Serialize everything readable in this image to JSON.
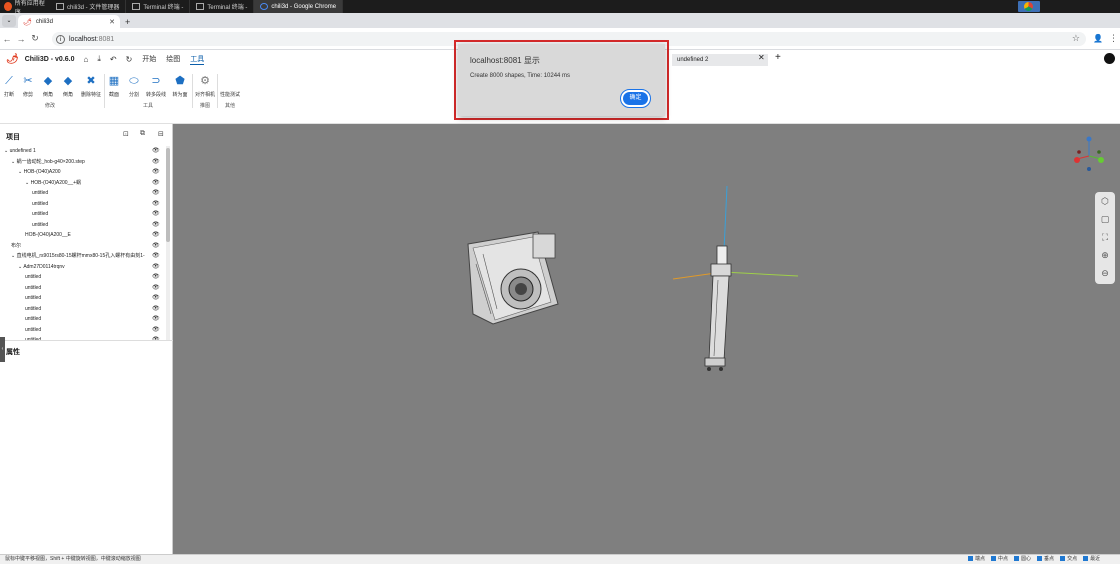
{
  "taskbar": {
    "start_label": "所有应用程序",
    "items": [
      {
        "label": "chili3d - 文件管理器",
        "active": false
      },
      {
        "label": "Terminal 终端 -",
        "active": false
      },
      {
        "label": "Terminal 终端 -",
        "active": false
      },
      {
        "label": "chili3d - Google Chrome",
        "active": true
      }
    ]
  },
  "browser": {
    "tab_title": "chili3d",
    "url_host": "localhost",
    "url_port": ":8081"
  },
  "app": {
    "title": "Chili3D - v0.6.0",
    "menus": [
      {
        "label": "开始",
        "active": false
      },
      {
        "label": "绘图",
        "active": false
      },
      {
        "label": "工具",
        "active": true
      }
    ],
    "doc_tab": "undefined 2"
  },
  "ribbon": {
    "tools": [
      {
        "label": "打断",
        "icon": "break-icon",
        "glyph": "⟋"
      },
      {
        "label": "修剪",
        "icon": "trim-icon",
        "glyph": "✂"
      },
      {
        "label": "倒角",
        "icon": "chamfer-icon",
        "glyph": "◆"
      },
      {
        "label": "倒角",
        "icon": "fillet-icon",
        "glyph": "◆"
      },
      {
        "label": "删除特征",
        "icon": "remove-feature-icon",
        "glyph": "✖"
      },
      {
        "label": "截面",
        "icon": "section-icon",
        "glyph": "▦"
      },
      {
        "label": "分割",
        "icon": "split-icon",
        "glyph": "⬭"
      },
      {
        "label": "转多段线",
        "icon": "polyline-icon",
        "glyph": "⊃"
      },
      {
        "label": "转为面",
        "icon": "to-face-icon",
        "glyph": "⬟"
      },
      {
        "label": "对齐相机",
        "icon": "align-camera-icon",
        "glyph": "⚙"
      },
      {
        "label": "性能测试",
        "icon": "performance-test-icon",
        "glyph": ""
      }
    ],
    "groups": [
      "修改",
      "工具",
      "推图",
      "其他"
    ]
  },
  "project": {
    "header": "项目",
    "tree": [
      {
        "label": "undefined 1",
        "indent": 0,
        "arrow": true
      },
      {
        "label": "蜗一齿动轮_hob-g40×200.step",
        "indent": 1,
        "arrow": true
      },
      {
        "label": "HOB-(O40)A200",
        "indent": 2,
        "arrow": true
      },
      {
        "label": "HOB-(O40)A200__+蜗",
        "indent": 3,
        "arrow": true
      },
      {
        "label": "untitled",
        "indent": 4,
        "arrow": false
      },
      {
        "label": "untitled",
        "indent": 4,
        "arrow": false
      },
      {
        "label": "untitled",
        "indent": 4,
        "arrow": false
      },
      {
        "label": "untitled",
        "indent": 4,
        "arrow": false
      },
      {
        "label": "HOB-(O40)A200__E",
        "indent": 3,
        "arrow": false
      },
      {
        "label": "布尔",
        "indent": 1,
        "arrow": false
      },
      {
        "label": "直线电机_rs9015rs80-15螺杆mmx80-15孔入螺杆有由刻1-",
        "indent": 1,
        "arrow": true
      },
      {
        "label": "Adm27D0114trqnv",
        "indent": 2,
        "arrow": true
      },
      {
        "label": "untitled",
        "indent": 3,
        "arrow": false
      },
      {
        "label": "untitled",
        "indent": 3,
        "arrow": false
      },
      {
        "label": "untitled",
        "indent": 3,
        "arrow": false
      },
      {
        "label": "untitled",
        "indent": 3,
        "arrow": false
      },
      {
        "label": "untitled",
        "indent": 3,
        "arrow": false
      },
      {
        "label": "untitled",
        "indent": 3,
        "arrow": false
      },
      {
        "label": "untitled",
        "indent": 3,
        "arrow": false
      }
    ]
  },
  "properties": {
    "header": "属性"
  },
  "dialog": {
    "title": "localhost:8081 显示",
    "message": "Create 8000 shapes, Time: 10244 ms",
    "ok_label": "确定"
  },
  "status": {
    "hint": "鼠标中键平移视图，Shift + 中键旋转视图，中键滚动缩放视图",
    "snaps": [
      "端点",
      "中点",
      "圆心",
      "垂点",
      "交点",
      "最近"
    ]
  },
  "colors": {
    "accent": "#1a73e8",
    "viewport_bg": "#7f7f7f",
    "dialog_highlight": "#d62a2a"
  }
}
